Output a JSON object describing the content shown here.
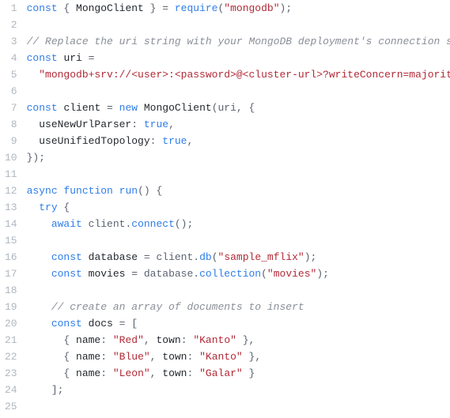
{
  "lines": [
    {
      "n": "1",
      "tokens": [
        [
          "kw",
          "const"
        ],
        [
          "pun",
          " { "
        ],
        [
          "id",
          "MongoClient"
        ],
        [
          "pun",
          " } = "
        ],
        [
          "fn",
          "require"
        ],
        [
          "pun",
          "("
        ],
        [
          "str",
          "\"mongodb\""
        ],
        [
          "pun",
          ");"
        ]
      ]
    },
    {
      "n": "2",
      "tokens": []
    },
    {
      "n": "3",
      "tokens": [
        [
          "cmt",
          "// Replace the uri string with your MongoDB deployment's connection string."
        ]
      ]
    },
    {
      "n": "4",
      "tokens": [
        [
          "kw",
          "const"
        ],
        [
          "pun",
          " "
        ],
        [
          "id",
          "uri"
        ],
        [
          "pun",
          " ="
        ]
      ]
    },
    {
      "n": "5",
      "tokens": [
        [
          "pun",
          "  "
        ],
        [
          "str",
          "\"mongodb+srv://<user>:<password>@<cluster-url>?writeConcern=majority\""
        ],
        [
          "pun",
          ";"
        ]
      ]
    },
    {
      "n": "6",
      "tokens": []
    },
    {
      "n": "7",
      "tokens": [
        [
          "kw",
          "const"
        ],
        [
          "pun",
          " "
        ],
        [
          "id",
          "client"
        ],
        [
          "pun",
          " = "
        ],
        [
          "kw",
          "new"
        ],
        [
          "pun",
          " "
        ],
        [
          "id",
          "MongoClient"
        ],
        [
          "pun",
          "(uri, {"
        ]
      ]
    },
    {
      "n": "8",
      "tokens": [
        [
          "pun",
          "  "
        ],
        [
          "prop",
          "useNewUrlParser"
        ],
        [
          "pun",
          ": "
        ],
        [
          "bool",
          "true"
        ],
        [
          "pun",
          ","
        ]
      ]
    },
    {
      "n": "9",
      "tokens": [
        [
          "pun",
          "  "
        ],
        [
          "prop",
          "useUnifiedTopology"
        ],
        [
          "pun",
          ": "
        ],
        [
          "bool",
          "true"
        ],
        [
          "pun",
          ","
        ]
      ]
    },
    {
      "n": "10",
      "tokens": [
        [
          "pun",
          "});"
        ]
      ]
    },
    {
      "n": "11",
      "tokens": []
    },
    {
      "n": "12",
      "tokens": [
        [
          "kw",
          "async"
        ],
        [
          "pun",
          " "
        ],
        [
          "kw",
          "function"
        ],
        [
          "pun",
          " "
        ],
        [
          "fn",
          "run"
        ],
        [
          "pun",
          "() {"
        ]
      ]
    },
    {
      "n": "13",
      "tokens": [
        [
          "pun",
          "  "
        ],
        [
          "kw",
          "try"
        ],
        [
          "pun",
          " {"
        ]
      ]
    },
    {
      "n": "14",
      "tokens": [
        [
          "pun",
          "    "
        ],
        [
          "kw",
          "await"
        ],
        [
          "pun",
          " client."
        ],
        [
          "fn",
          "connect"
        ],
        [
          "pun",
          "();"
        ]
      ]
    },
    {
      "n": "15",
      "tokens": []
    },
    {
      "n": "16",
      "tokens": [
        [
          "pun",
          "    "
        ],
        [
          "kw",
          "const"
        ],
        [
          "pun",
          " "
        ],
        [
          "id",
          "database"
        ],
        [
          "pun",
          " = client."
        ],
        [
          "fn",
          "db"
        ],
        [
          "pun",
          "("
        ],
        [
          "str",
          "\"sample_mflix\""
        ],
        [
          "pun",
          ");"
        ]
      ]
    },
    {
      "n": "17",
      "tokens": [
        [
          "pun",
          "    "
        ],
        [
          "kw",
          "const"
        ],
        [
          "pun",
          " "
        ],
        [
          "id",
          "movies"
        ],
        [
          "pun",
          " = database."
        ],
        [
          "fn",
          "collection"
        ],
        [
          "pun",
          "("
        ],
        [
          "str",
          "\"movies\""
        ],
        [
          "pun",
          ");"
        ]
      ]
    },
    {
      "n": "18",
      "tokens": []
    },
    {
      "n": "19",
      "tokens": [
        [
          "pun",
          "    "
        ],
        [
          "cmt",
          "// create an array of documents to insert"
        ]
      ]
    },
    {
      "n": "20",
      "tokens": [
        [
          "pun",
          "    "
        ],
        [
          "kw",
          "const"
        ],
        [
          "pun",
          " "
        ],
        [
          "id",
          "docs"
        ],
        [
          "pun",
          " = ["
        ]
      ]
    },
    {
      "n": "21",
      "tokens": [
        [
          "pun",
          "      { "
        ],
        [
          "prop",
          "name"
        ],
        [
          "pun",
          ": "
        ],
        [
          "str",
          "\"Red\""
        ],
        [
          "pun",
          ", "
        ],
        [
          "prop",
          "town"
        ],
        [
          "pun",
          ": "
        ],
        [
          "str",
          "\"Kanto\""
        ],
        [
          "pun",
          " },"
        ]
      ]
    },
    {
      "n": "22",
      "tokens": [
        [
          "pun",
          "      { "
        ],
        [
          "prop",
          "name"
        ],
        [
          "pun",
          ": "
        ],
        [
          "str",
          "\"Blue\""
        ],
        [
          "pun",
          ", "
        ],
        [
          "prop",
          "town"
        ],
        [
          "pun",
          ": "
        ],
        [
          "str",
          "\"Kanto\""
        ],
        [
          "pun",
          " },"
        ]
      ]
    },
    {
      "n": "23",
      "tokens": [
        [
          "pun",
          "      { "
        ],
        [
          "prop",
          "name"
        ],
        [
          "pun",
          ": "
        ],
        [
          "str",
          "\"Leon\""
        ],
        [
          "pun",
          ", "
        ],
        [
          "prop",
          "town"
        ],
        [
          "pun",
          ": "
        ],
        [
          "str",
          "\"Galar\""
        ],
        [
          "pun",
          " }"
        ]
      ]
    },
    {
      "n": "24",
      "tokens": [
        [
          "pun",
          "    ];"
        ]
      ]
    },
    {
      "n": "25",
      "tokens": []
    }
  ]
}
